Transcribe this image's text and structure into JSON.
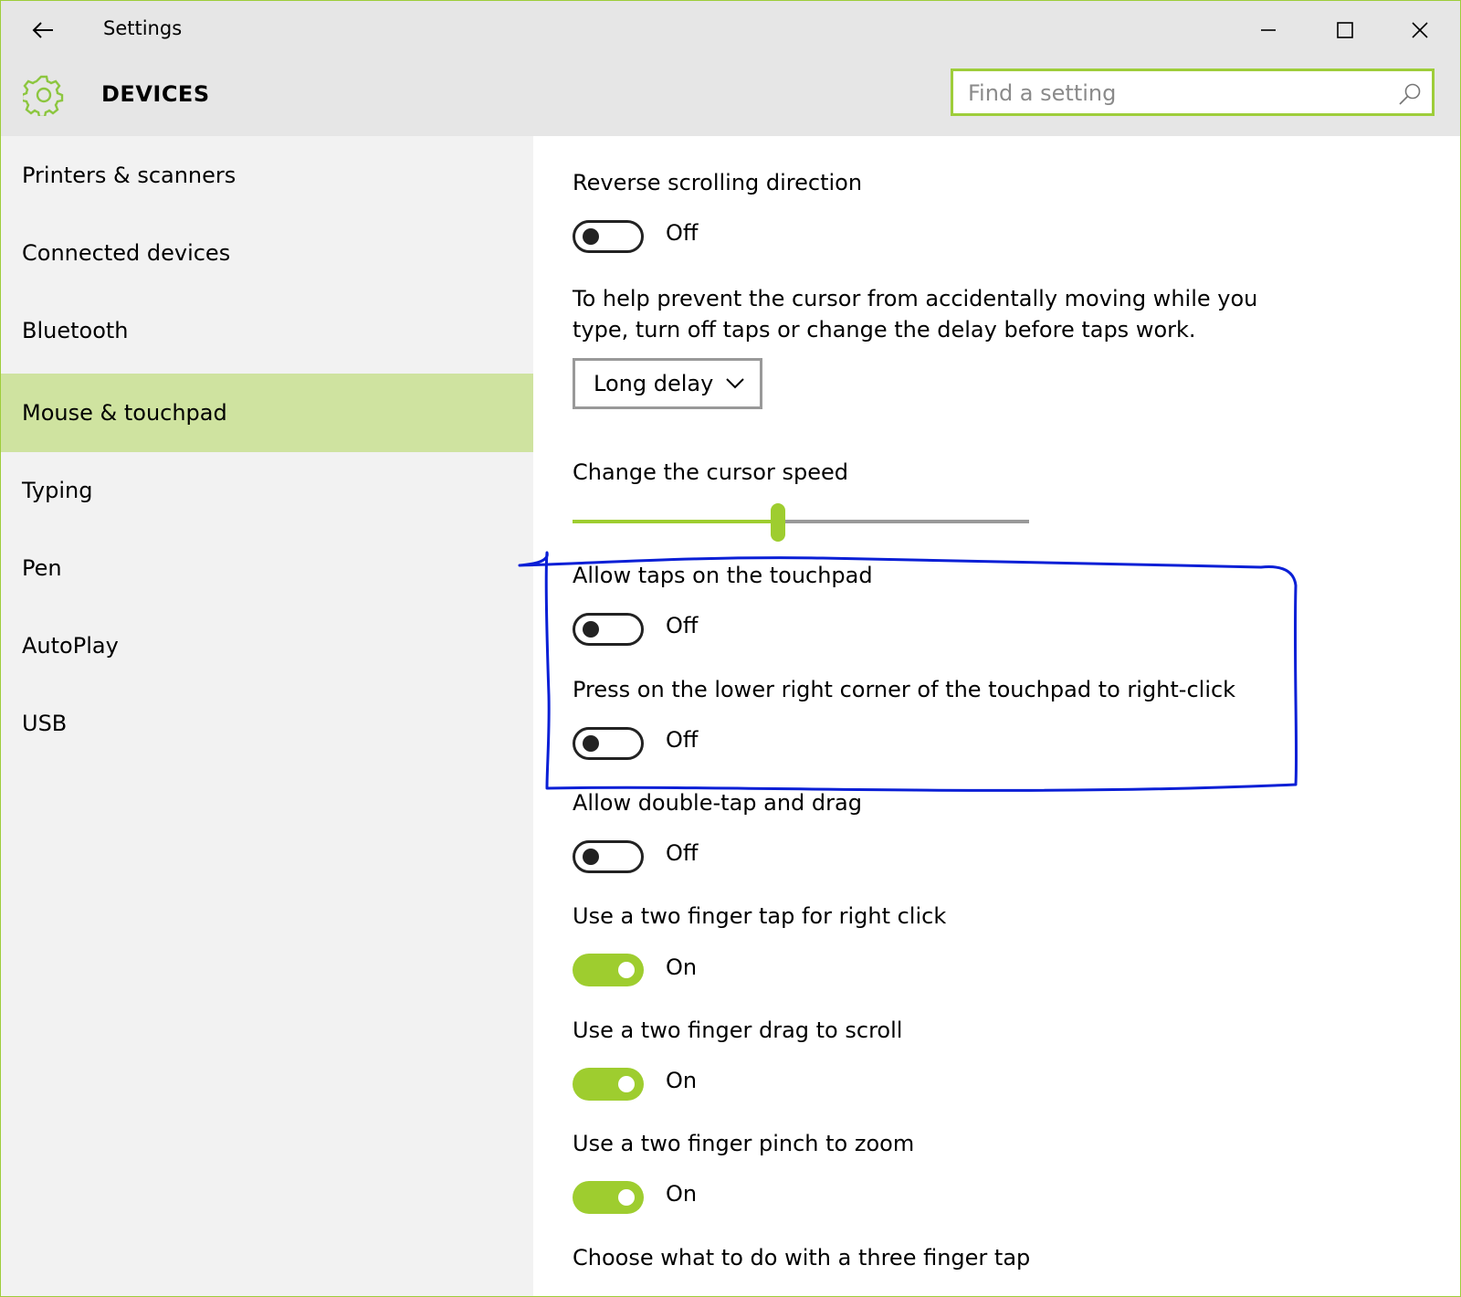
{
  "window": {
    "title": "Settings"
  },
  "header": {
    "section_title": "DEVICES",
    "search_placeholder": "Find a setting"
  },
  "sidebar": {
    "items": [
      {
        "label": "Printers & scanners",
        "selected": false
      },
      {
        "label": "Connected devices",
        "selected": false
      },
      {
        "label": "Bluetooth",
        "selected": false
      },
      {
        "label": "Mouse & touchpad",
        "selected": true
      },
      {
        "label": "Typing",
        "selected": false
      },
      {
        "label": "Pen",
        "selected": false
      },
      {
        "label": "AutoPlay",
        "selected": false
      },
      {
        "label": "USB",
        "selected": false
      }
    ]
  },
  "content": {
    "reverse_scroll": {
      "label": "Reverse scrolling direction",
      "state": "Off"
    },
    "tap_delay_text": "To help prevent the cursor from accidentally moving while you type, turn off taps or change the delay before taps work.",
    "tap_delay_value": "Long delay",
    "cursor_speed": {
      "label": "Change the cursor speed",
      "value_fraction": 0.45
    },
    "allow_taps": {
      "label": "Allow taps on the touchpad",
      "state": "Off"
    },
    "lower_right": {
      "label": "Press on the lower right corner of the touchpad to right-click",
      "state": "Off"
    },
    "double_tap": {
      "label": "Allow double-tap and drag",
      "state": "Off"
    },
    "two_finger_tap": {
      "label": "Use a two finger tap for right click",
      "state": "On"
    },
    "two_finger_drag": {
      "label": "Use a two finger drag to scroll",
      "state": "On"
    },
    "two_finger_pinch": {
      "label": "Use a two finger pinch to zoom",
      "state": "On"
    },
    "three_finger_tap": {
      "label": "Choose what to do with a three finger tap"
    }
  },
  "colors": {
    "accent": "#9ecd2f",
    "selected_bg": "#cfe3a0",
    "annotation": "#0a1fd6"
  }
}
